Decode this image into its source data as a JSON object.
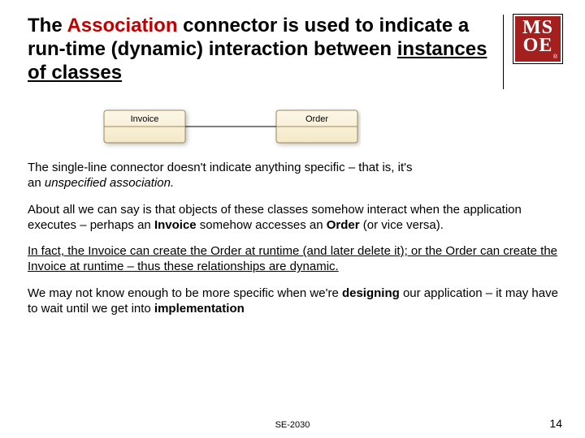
{
  "title": {
    "pre": "The ",
    "highlight": "Association",
    "mid": " connector is used to indicate a run-time (dynamic) interaction between ",
    "ul": "instances of classes"
  },
  "logo": {
    "line1": "MS",
    "line2": "OE"
  },
  "diagram": {
    "left_class": "Invoice",
    "right_class": "Order"
  },
  "para1": {
    "a": "The single-line connector doesn't indicate anything specific – that is, it's an ",
    "b": "unspecified association.",
    "c": ""
  },
  "para2": {
    "a": "About all we can say is that objects of these classes somehow interact when the application executes – perhaps an ",
    "b1": "Invoice",
    "mid": " somehow accesses  an ",
    "b2": "Order",
    "c": " (or vice versa)."
  },
  "para3": "In fact, the Invoice can create the Order at runtime (and later delete it); or the Order can create the Invoice at runtime – thus these relationships are dynamic.",
  "para4": {
    "a": "We may not know enough to be more specific when we're ",
    "b1": "designing",
    "mid": " our application – it may have to wait until we get into ",
    "b2": "implementation"
  },
  "footer": "SE-2030",
  "page": "14"
}
